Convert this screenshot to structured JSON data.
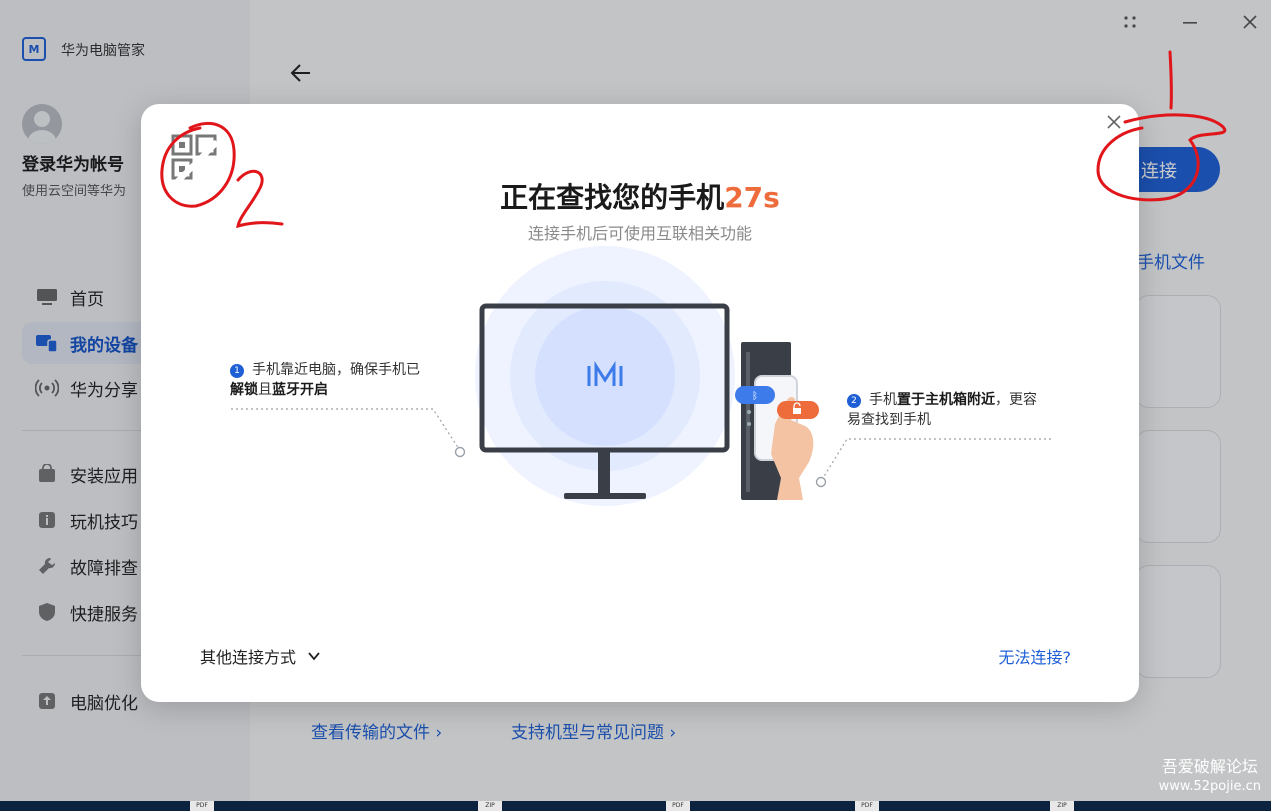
{
  "app": {
    "name": "华为电脑管家",
    "logo_text": "M"
  },
  "account": {
    "title": "登录华为帐号",
    "subtitle": "使用云空间等华为"
  },
  "sidebar": {
    "items": [
      {
        "label": "首页",
        "icon": "monitor-icon"
      },
      {
        "label": "我的设备",
        "icon": "devices-icon",
        "active": true
      },
      {
        "label": "华为分享",
        "icon": "wireless-icon"
      },
      {
        "label": "安装应用",
        "icon": "bag-icon"
      },
      {
        "label": "玩机技巧",
        "icon": "info-icon"
      },
      {
        "label": "故障排查",
        "icon": "wrench-icon"
      },
      {
        "label": "快捷服务",
        "icon": "shield-icon"
      },
      {
        "label": "电脑优化",
        "icon": "upload-icon"
      }
    ]
  },
  "content": {
    "connect_button": "连接",
    "side_link": "看手机文件",
    "bottom_links": [
      "查看传输的文件 ›",
      "支持机型与常见问题 ›"
    ]
  },
  "dialog": {
    "title_prefix": "正在查找您的手机",
    "countdown": "27s",
    "subtitle": "连接手机后可使用互联相关功能",
    "step1": {
      "num": "1",
      "line1": "手机靠近电脑，确保手机已",
      "line2_bold1": "解锁",
      "line2_plain": "且",
      "line2_bold2": "蓝牙开启"
    },
    "step2": {
      "num": "2",
      "line1_plain1": "手机",
      "line1_bold": "置于主机箱附近",
      "line1_plain2": "，更容",
      "line2": "易查找到手机"
    },
    "other_methods": "其他连接方式",
    "cant_connect": "无法连接?"
  },
  "annotations": {
    "mark1": "1",
    "mark2": "2",
    "color": "#e0161b"
  },
  "watermark": {
    "title": "吾爱破解论坛",
    "url": "www.52pojie.cn"
  },
  "colors": {
    "accent": "#1e5fd6",
    "countdown": "#ee6c3c"
  }
}
